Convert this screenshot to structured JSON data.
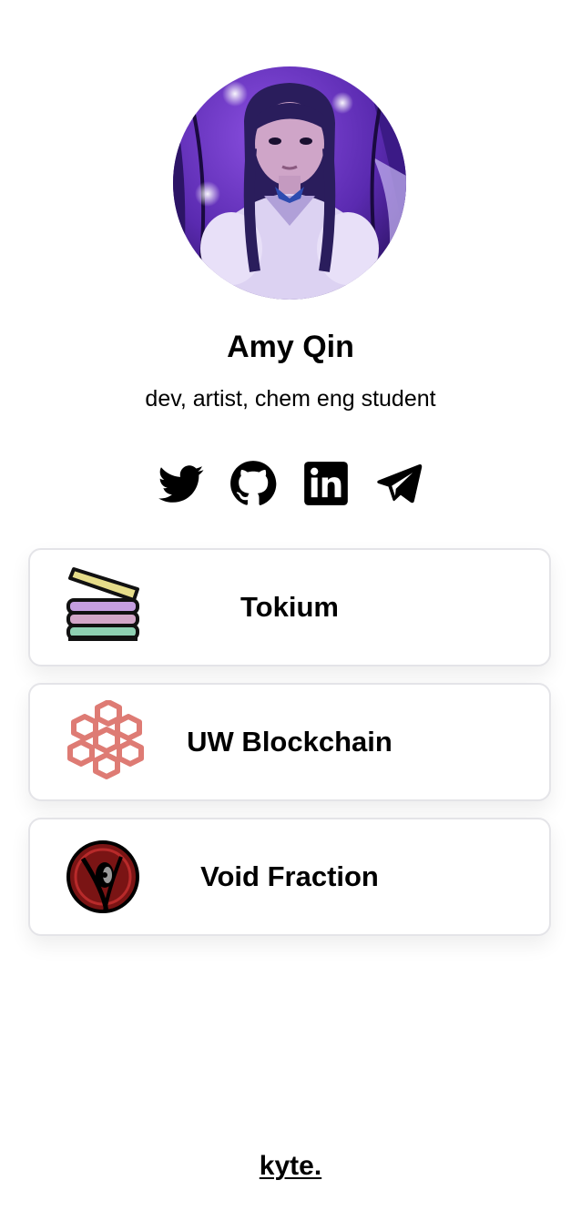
{
  "profile": {
    "name": "Amy Qin",
    "bio": "dev, artist, chem eng student",
    "avatar_icon": "avatar-portrait-illustration"
  },
  "socials": [
    {
      "icon": "twitter-icon"
    },
    {
      "icon": "github-icon"
    },
    {
      "icon": "linkedin-icon"
    },
    {
      "icon": "telegram-icon"
    }
  ],
  "links": [
    {
      "label": "Tokium",
      "icon": "tokium-logo-icon"
    },
    {
      "label": "UW Blockchain",
      "icon": "uw-blockchain-logo-icon"
    },
    {
      "label": "Void Fraction",
      "icon": "void-fraction-logo-icon"
    }
  ],
  "footer": {
    "brand": "kyte."
  },
  "colors": {
    "background": "#ffffff",
    "card_border": "#e4e4e8",
    "text": "#000000"
  }
}
